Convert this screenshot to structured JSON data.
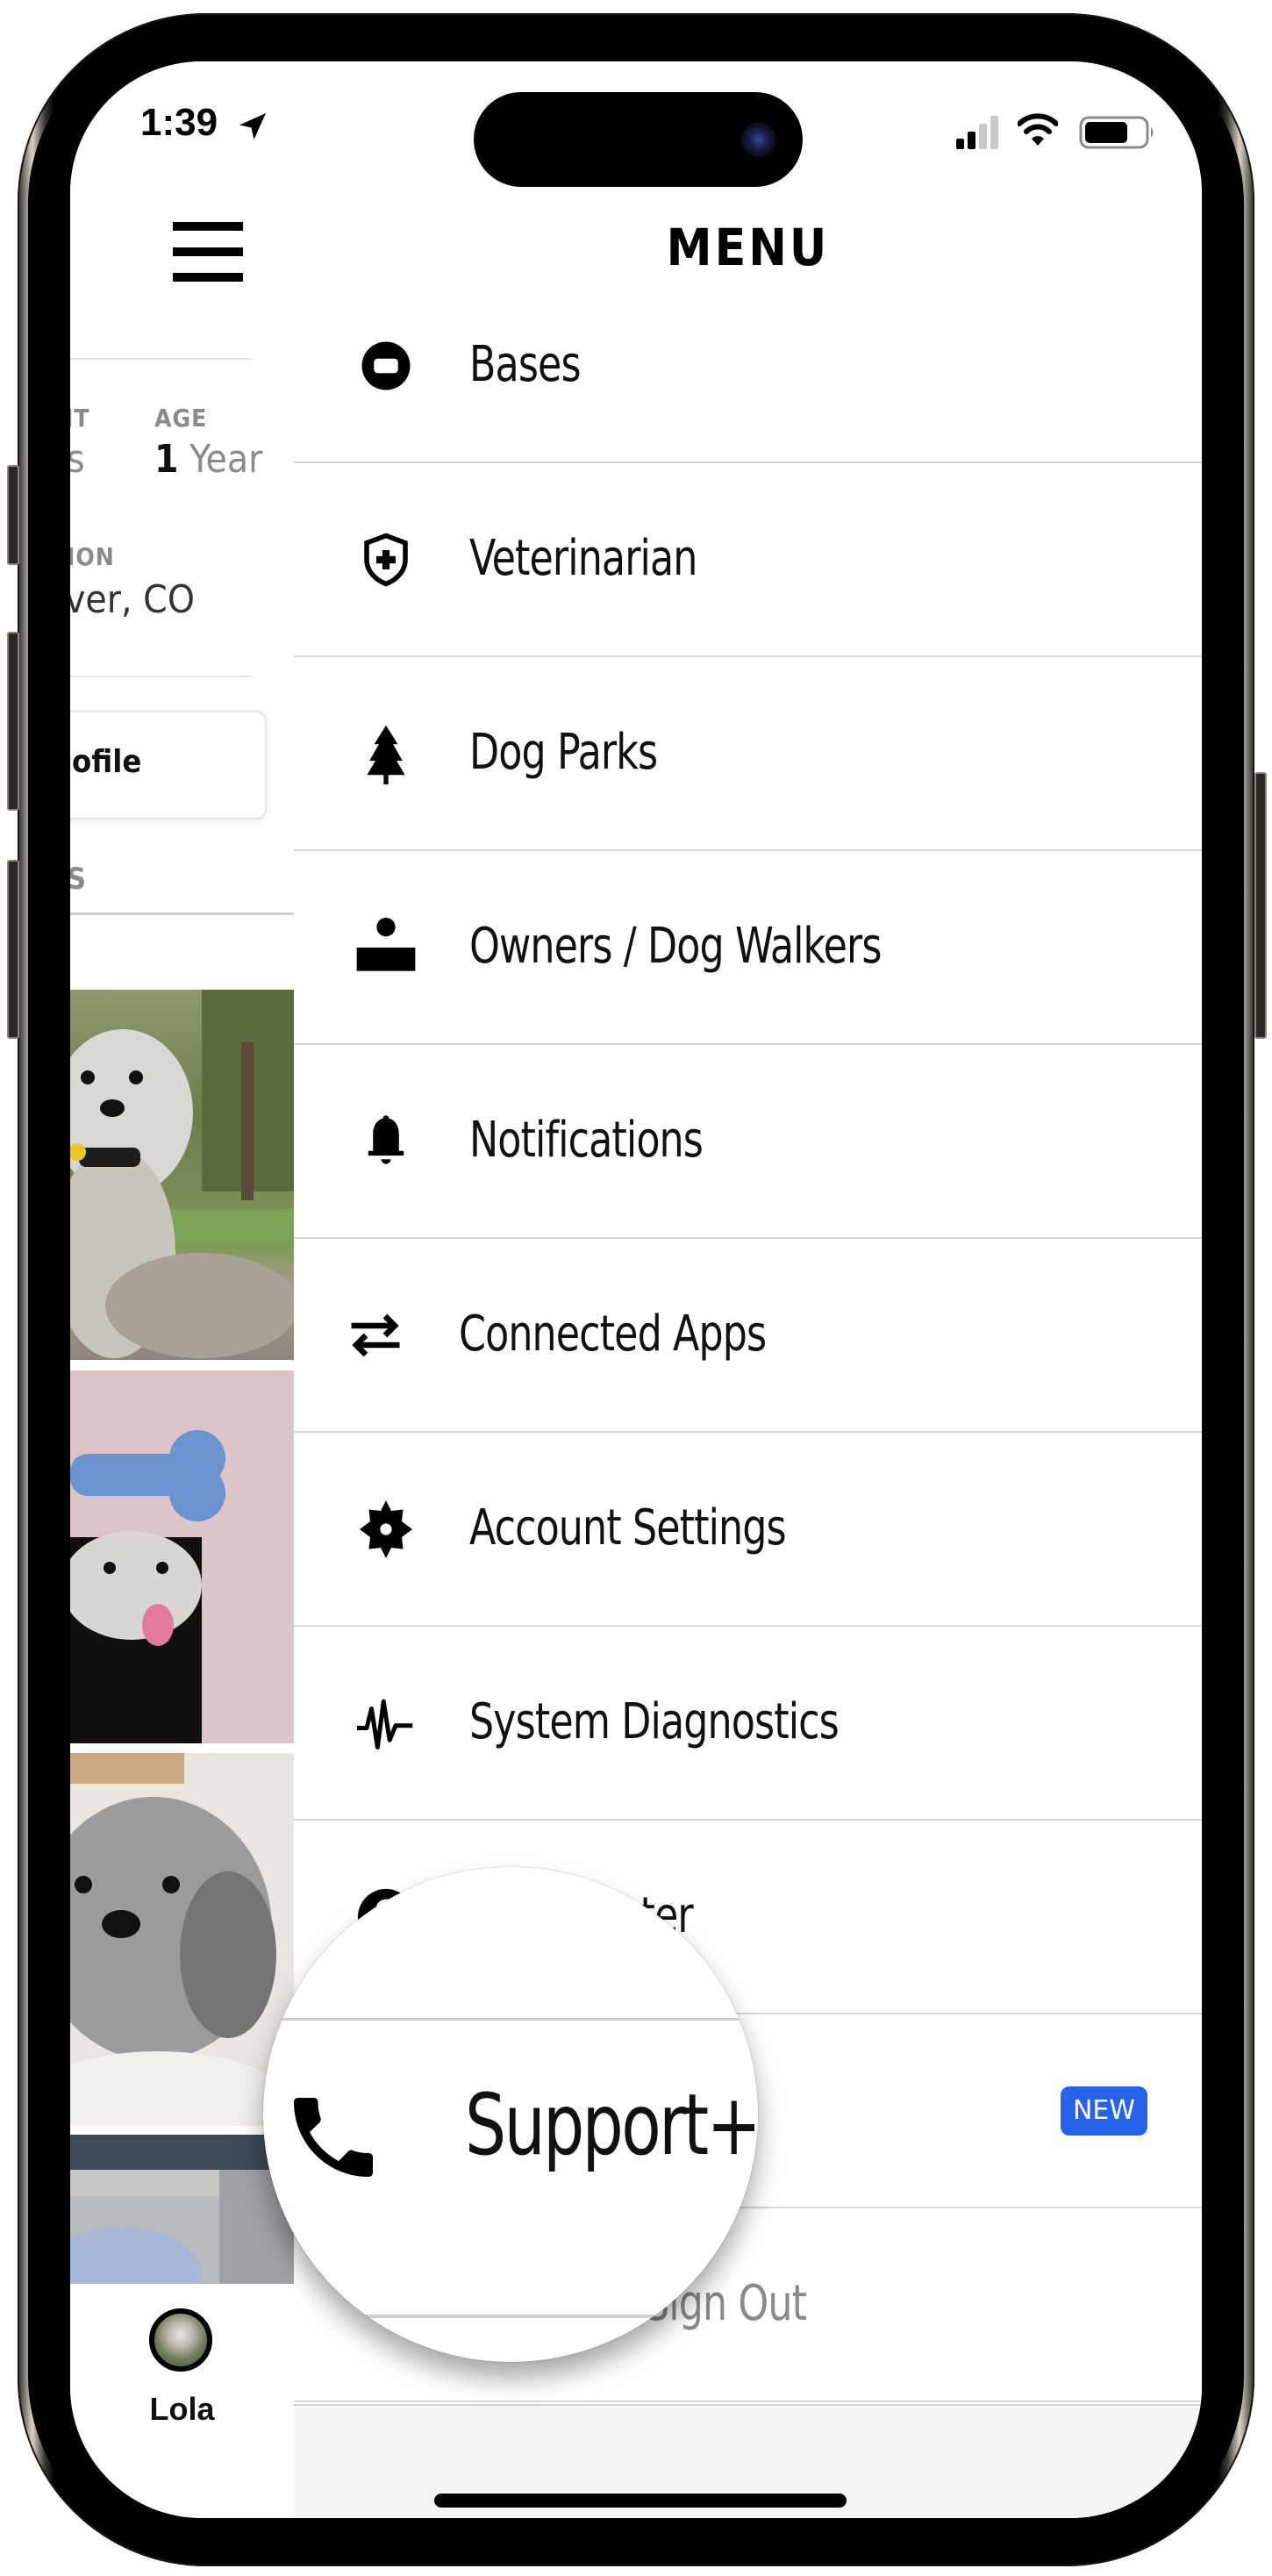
{
  "status_bar": {
    "time": "1:39",
    "location_active": true,
    "signal_bars_filled": 2,
    "signal_bars_total": 4,
    "battery_level": 0.7
  },
  "left_panel": {
    "stats": [
      {
        "label": "IT",
        "value": "s"
      },
      {
        "label": "AGE",
        "value_number": "1",
        "value_unit": "Year"
      }
    ],
    "location": {
      "label": "ION",
      "value": "ver, CO"
    },
    "profile_button": "ofile",
    "section_label": "S",
    "photos": [
      {
        "alt": "dog-in-park"
      },
      {
        "alt": "dog-in-doghouse"
      },
      {
        "alt": "dog-closeup"
      },
      {
        "alt": "dog-in-car"
      }
    ],
    "tab": {
      "label": "Lola"
    }
  },
  "menu": {
    "title": "MENU",
    "items": [
      {
        "label": "Bases",
        "icon": "base-icon"
      },
      {
        "label": "Veterinarian",
        "icon": "shield-plus-icon"
      },
      {
        "label": "Dog Parks",
        "icon": "tree-icon"
      },
      {
        "label": "Owners / Dog Walkers",
        "icon": "person-icon"
      },
      {
        "label": "Notifications",
        "icon": "bell-icon"
      },
      {
        "label": "Connected Apps",
        "icon": "swap-arrows-icon"
      },
      {
        "label": "Account Settings",
        "icon": "gear-icon"
      },
      {
        "label": "System Diagnostics",
        "icon": "pulse-icon"
      },
      {
        "label": "Help Center",
        "icon": "help-icon",
        "visible_text": "nter"
      },
      {
        "label": "Support+",
        "icon": "phone-icon",
        "badge": "NEW"
      },
      {
        "label": "Sign Out",
        "icon": "",
        "muted": true
      }
    ]
  },
  "magnifier": {
    "label": "Support+",
    "icon": "phone-icon"
  },
  "colors": {
    "badge": "#2563eb",
    "divider": "#d6d6d6",
    "muted_text": "#8a8a8a"
  }
}
